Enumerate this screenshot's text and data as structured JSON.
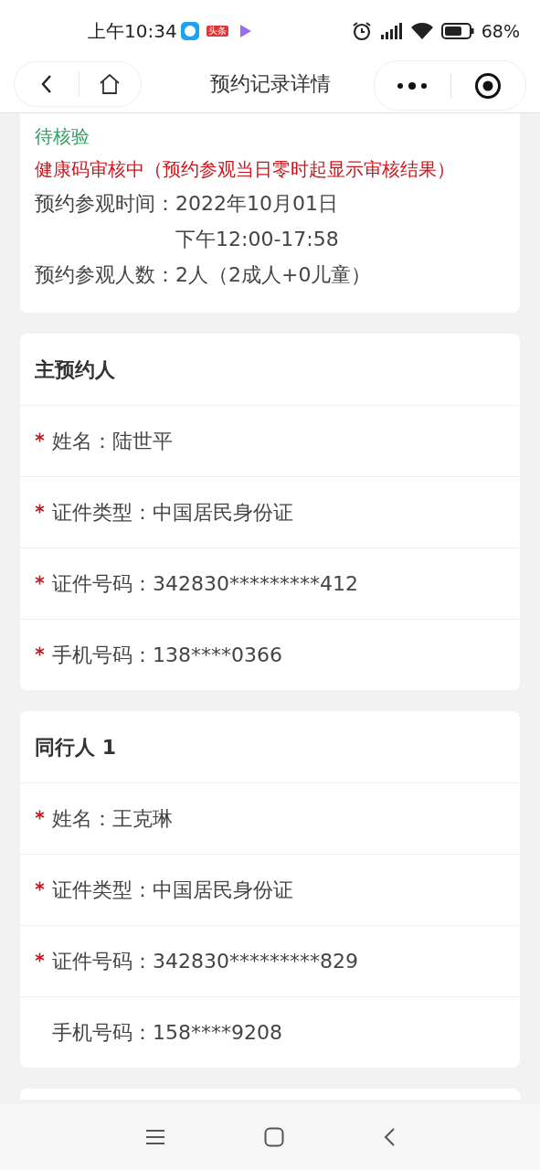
{
  "status_bar": {
    "time": "上午10:34",
    "app_badge": "头条",
    "battery": "68%"
  },
  "nav": {
    "title": "预约记录详情"
  },
  "summary": {
    "status": "待核验",
    "health_notice": "健康码审核中（预约参观当日零时起显示审核结果）",
    "rows": [
      {
        "label": "预约参观时间：",
        "lines": [
          "2022年10月01日",
          "下午12:00-17:58"
        ]
      },
      {
        "label": "预约参观人数：",
        "lines": [
          "2人（2成人+0儿童）"
        ]
      }
    ]
  },
  "sections": [
    {
      "title": "主预约人",
      "fields": [
        {
          "required": true,
          "text": "姓名：陆世平"
        },
        {
          "required": true,
          "text": "证件类型：中国居民身份证"
        },
        {
          "required": true,
          "text": "证件号码：342830*********412"
        },
        {
          "required": true,
          "text": "手机号码：138****0366"
        }
      ]
    },
    {
      "title": "同行人 1",
      "fields": [
        {
          "required": true,
          "text": "姓名：王克琳"
        },
        {
          "required": true,
          "text": "证件类型：中国居民身份证"
        },
        {
          "required": true,
          "text": "证件号码：342830*********829"
        },
        {
          "required": false,
          "text": "手机号码：158****9208"
        }
      ]
    }
  ]
}
